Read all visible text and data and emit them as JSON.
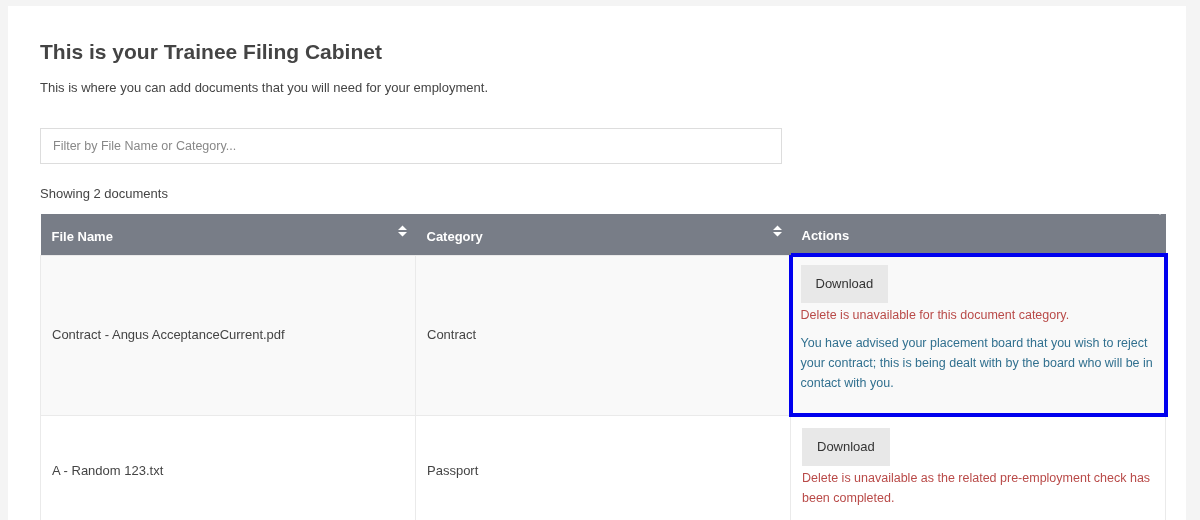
{
  "heading": "This is your Trainee Filing Cabinet",
  "intro": "This is where you can add documents that you will need for your employment.",
  "filter": {
    "placeholder": "Filter by File Name or Category..."
  },
  "count": "Showing 2 documents",
  "table": {
    "columns": [
      {
        "label": "File Name",
        "sortable": true
      },
      {
        "label": "Category",
        "sortable": true
      },
      {
        "label": "Actions",
        "sortable": false
      }
    ],
    "rows": [
      {
        "file_name": "Contract - Angus AcceptanceCurrent.pdf",
        "category": "Contract",
        "button": "Download",
        "highlighted": true,
        "messages": [
          {
            "kind": "error",
            "text": "Delete is unavailable for this document category."
          },
          {
            "kind": "info",
            "text": "You have advised your placement board that you wish to reject your contract; this is being dealt with by the board who will be in contact with you."
          }
        ]
      },
      {
        "file_name": "A - Random 123.txt",
        "category": "Passport",
        "button": "Download",
        "highlighted": false,
        "messages": [
          {
            "kind": "error",
            "text": "Delete is unavailable as the related pre-employment check has been completed."
          }
        ]
      }
    ]
  }
}
